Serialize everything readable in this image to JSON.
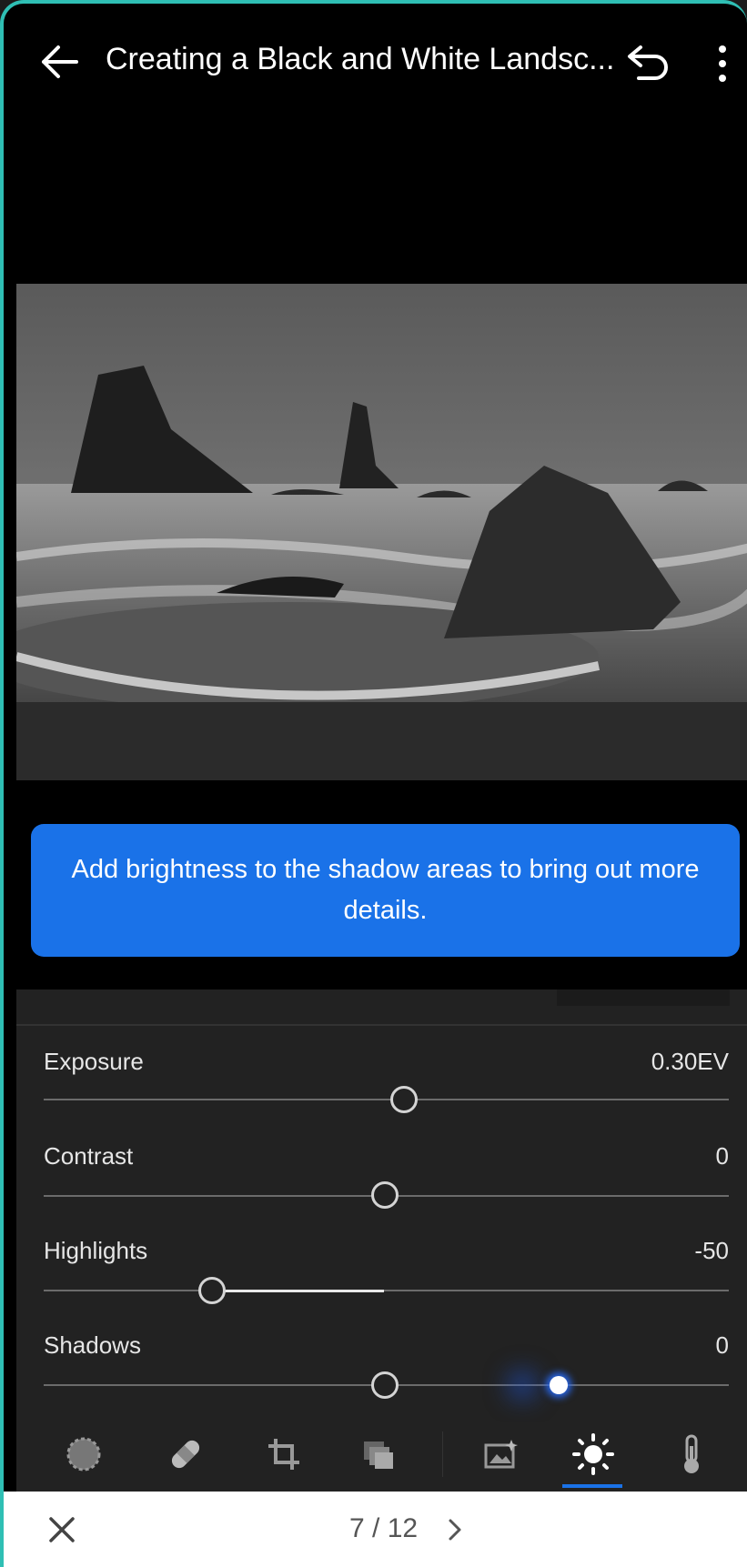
{
  "header": {
    "title": "Creating a Black and White Landsc...",
    "back_icon": "arrow-left-icon",
    "undo_icon": "undo-icon",
    "more_icon": "more-vertical-icon"
  },
  "tutorial": {
    "hint": "Add brightness to the shadow areas to bring out more details."
  },
  "sliders": [
    {
      "label": "Exposure",
      "value": "0.30EV",
      "level": 0.53
    },
    {
      "label": "Contrast",
      "value": "0",
      "level": 0.5
    },
    {
      "label": "Highlights",
      "value": "-50",
      "level": 0.25
    },
    {
      "label": "Shadows",
      "value": "0",
      "level": 0.5
    }
  ],
  "toolbar": {
    "tools": [
      "selective-icon",
      "healing-icon",
      "crop-icon",
      "presets-icon",
      "auto-icon",
      "light-icon",
      "color-temperature-icon"
    ],
    "active": "light-icon"
  },
  "footer": {
    "step": "7 / 12",
    "close_icon": "close-icon",
    "next_icon": "chevron-right-icon"
  },
  "colors": {
    "accent": "#1a72e8",
    "frame": "#2fbfb4"
  }
}
